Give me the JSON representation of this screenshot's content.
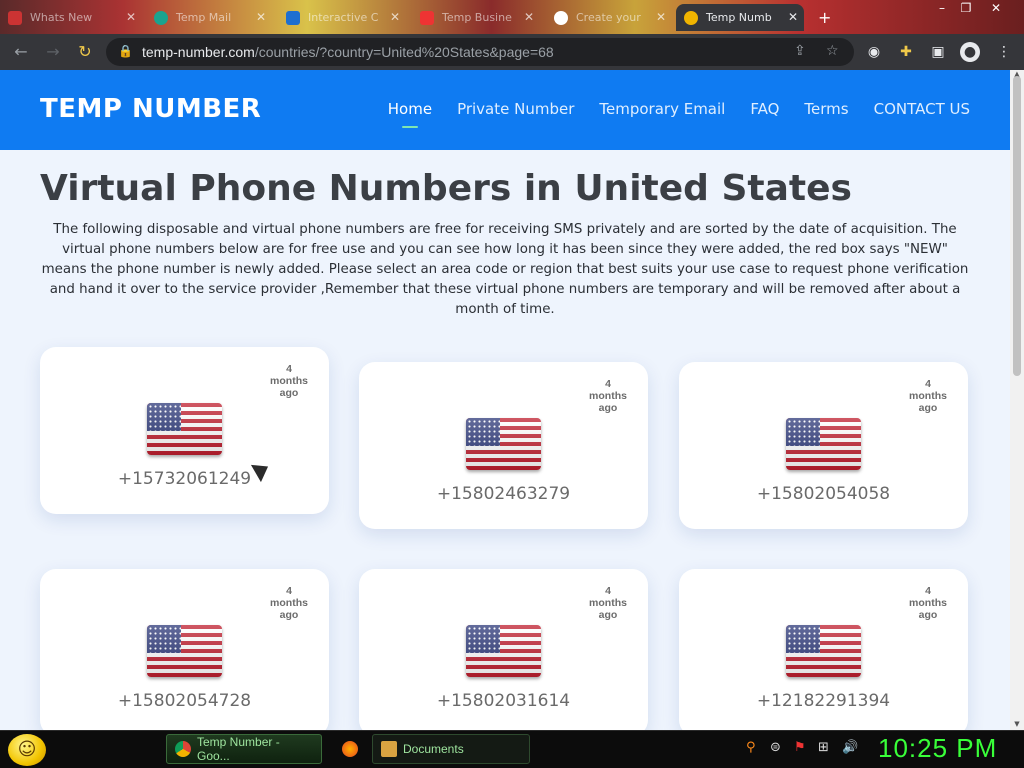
{
  "browser": {
    "tabs": [
      {
        "label": "Whats New",
        "active": false
      },
      {
        "label": "Temp Mail",
        "active": false
      },
      {
        "label": "Interactive C",
        "active": false
      },
      {
        "label": "Temp Busine",
        "active": false
      },
      {
        "label": "Create your",
        "active": false
      },
      {
        "label": "Temp Numb",
        "active": true
      }
    ],
    "url_host": "temp-number.com",
    "url_path": "/countries/?country=United%20States&page=68"
  },
  "site": {
    "logo": "TEMP NUMBER",
    "nav": [
      "Home",
      "Private Number",
      "Temporary Email",
      "FAQ",
      "Terms",
      "CONTACT US"
    ],
    "title_prefix": "Virtual Phone Numbers in ",
    "title_country": "United States",
    "intro": "The following disposable and virtual phone numbers are free for receiving SMS privately and are sorted by the date of acquisition. The virtual phone numbers below are for free use and you can see how long it has been since they were added, the red box says \"NEW\" means the phone number is newly added. Please select an area code or region that best suits your use case to request phone verification and hand it over to the service provider ,Remember that these virtual phone numbers are temporary and will be removed after about a month of time.",
    "cards": [
      {
        "number": "+15732061249",
        "ago": "4 months ago"
      },
      {
        "number": "+15802463279",
        "ago": "4 months ago"
      },
      {
        "number": "+15802054058",
        "ago": "4 months ago"
      },
      {
        "number": "+15802054728",
        "ago": "4 months ago"
      },
      {
        "number": "+15802031614",
        "ago": "4 months ago"
      },
      {
        "number": "+12182291394",
        "ago": "4 months ago"
      }
    ]
  },
  "taskbar": {
    "tasks": [
      {
        "label": "Temp Number - Goo...",
        "icon": "chrome-icon"
      },
      {
        "label": "Documents",
        "icon": "folder-icon"
      }
    ],
    "clock": "10:25 PM"
  },
  "colors": {
    "header_blue": "#0f7bf2",
    "page_bg": "#eef4fd",
    "clock_green": "#39ff39"
  }
}
